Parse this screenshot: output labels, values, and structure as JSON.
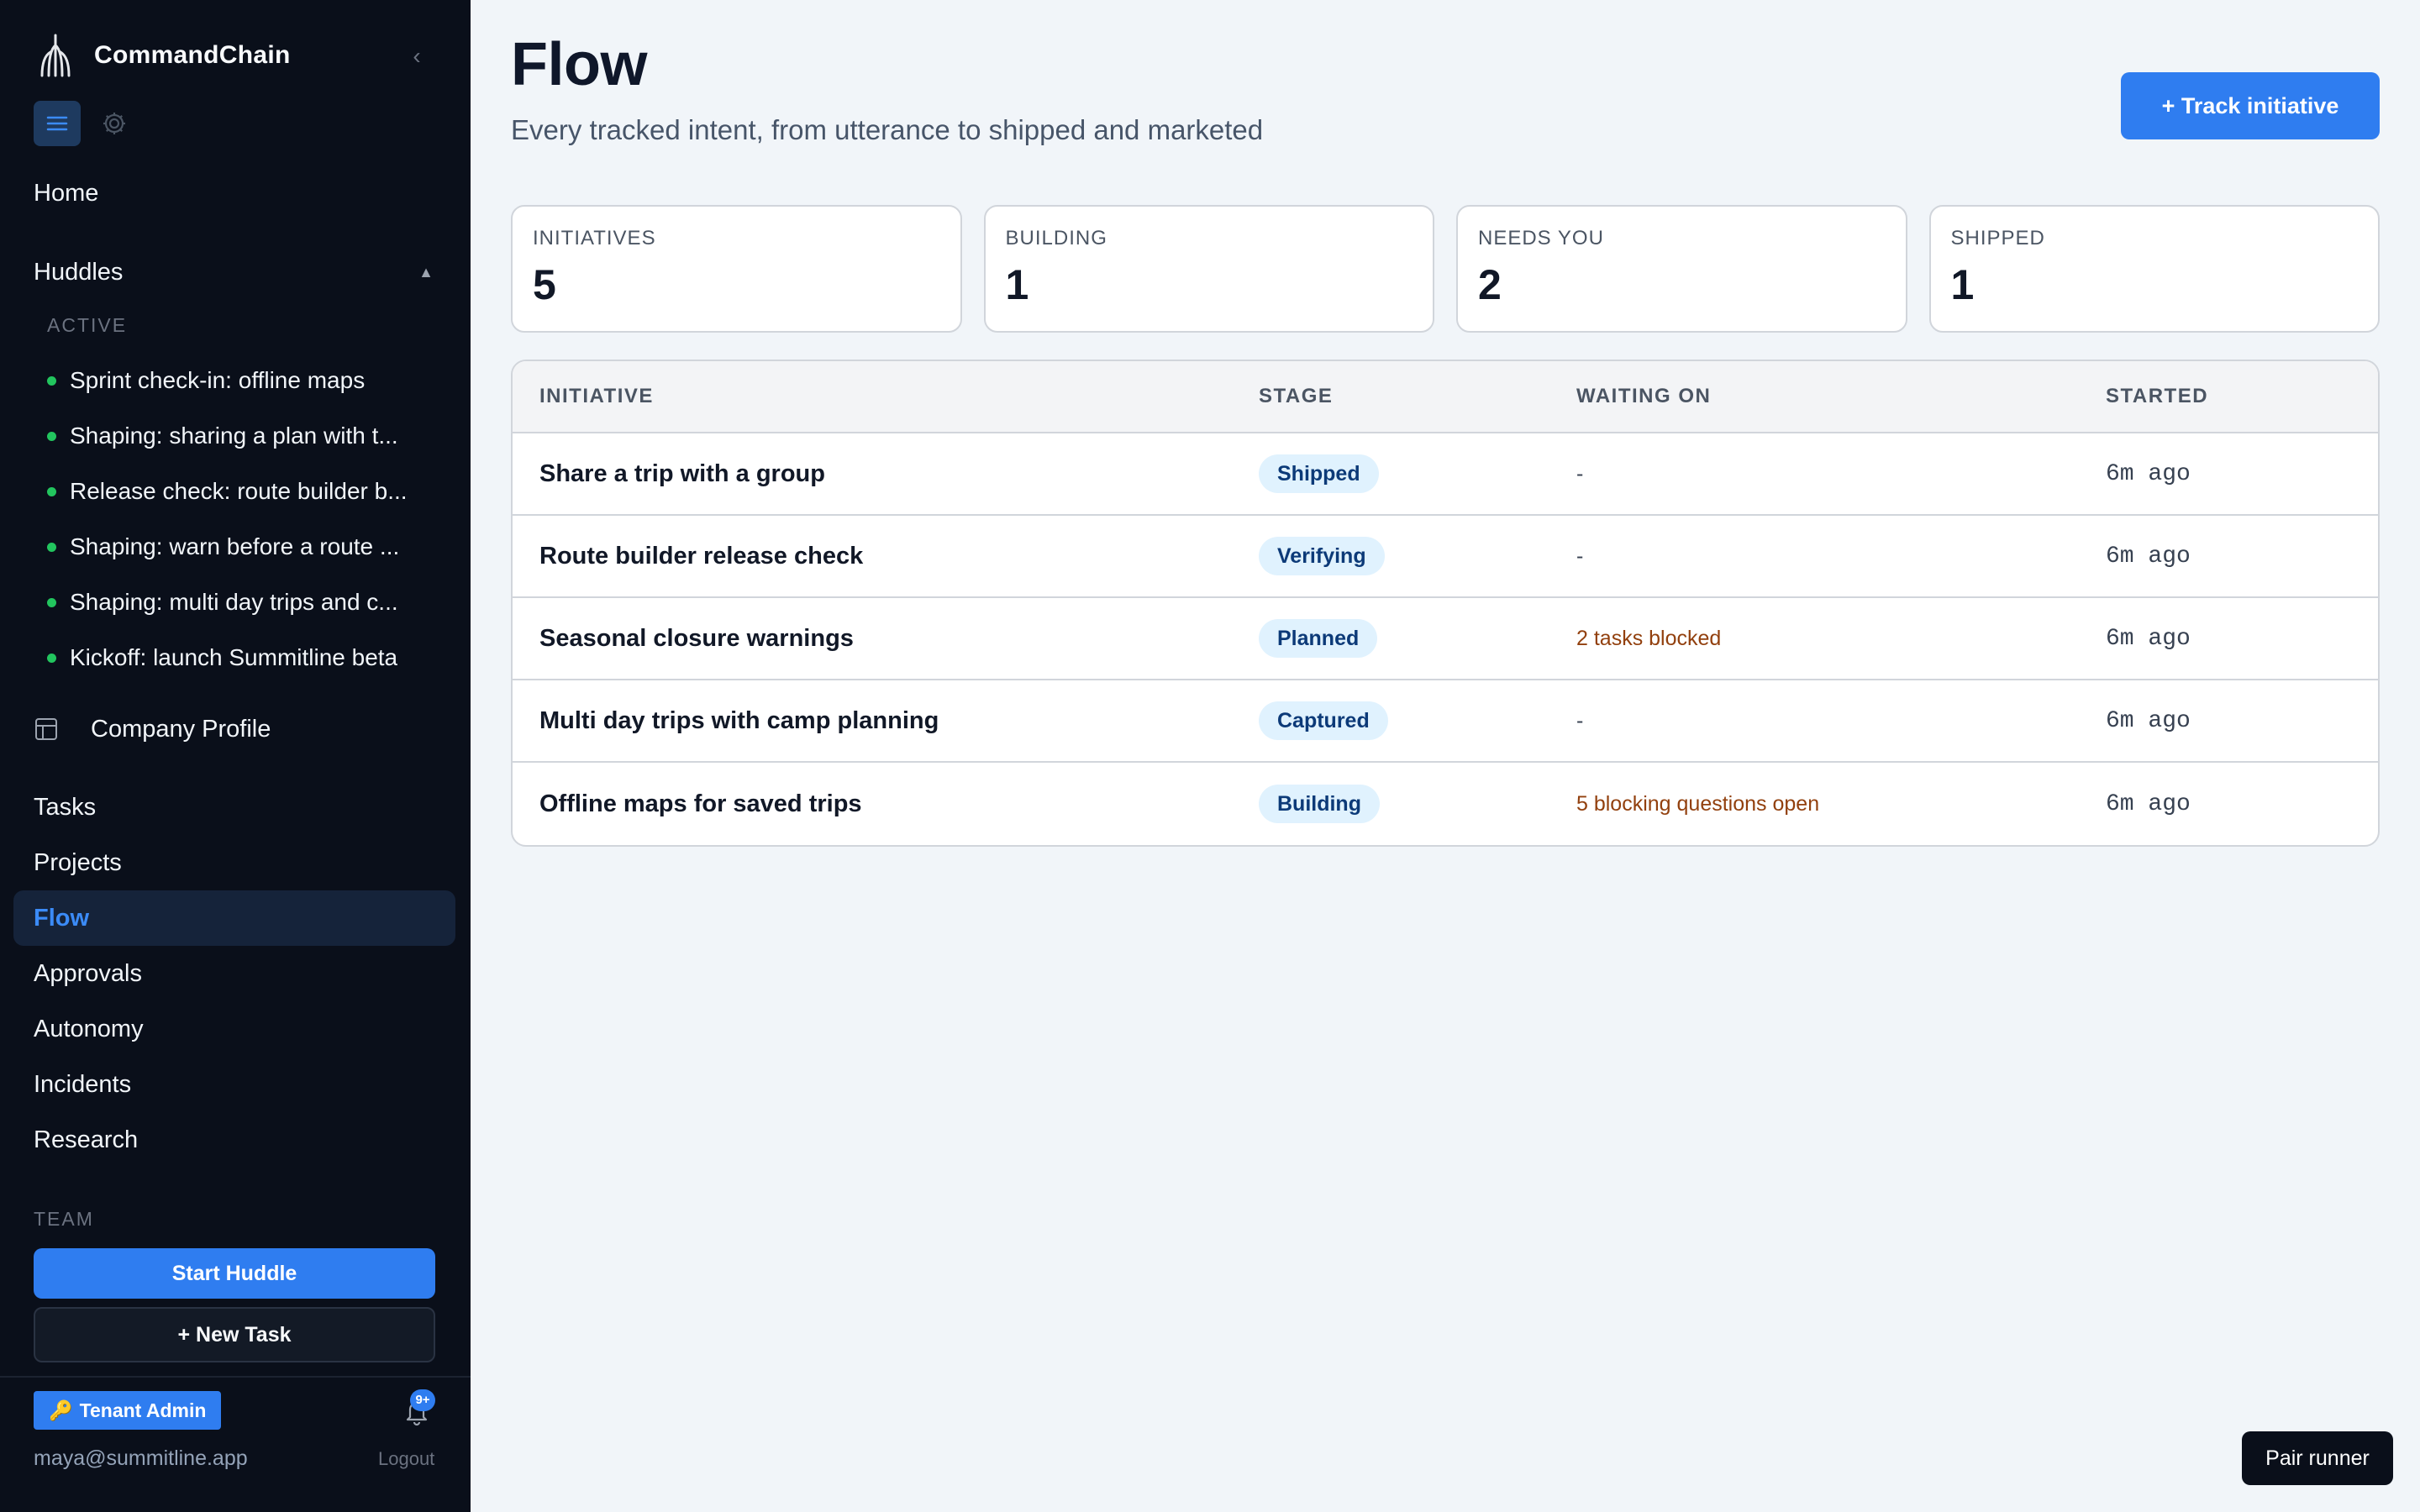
{
  "app": {
    "brand_name": "CommandChain",
    "collapse_icon": "chevron-left-icon"
  },
  "sidebar": {
    "home_label": "Home",
    "huddles": {
      "label": "Huddles",
      "caret": "▲",
      "section_label": "ACTIVE",
      "items": [
        "Sprint check-in: offline maps",
        "Shaping: sharing a plan with t...",
        "Release check: route builder b...",
        "Shaping: warn before a route ...",
        "Shaping: multi day trips and c...",
        "Kickoff: launch Summitline beta"
      ],
      "status_color": "#22c55e"
    },
    "company_profile_label": "Company Profile",
    "nav": [
      {
        "label": "Tasks",
        "active": false
      },
      {
        "label": "Projects",
        "active": false
      },
      {
        "label": "Flow",
        "active": true
      },
      {
        "label": "Approvals",
        "active": false
      },
      {
        "label": "Autonomy",
        "active": false
      },
      {
        "label": "Incidents",
        "active": false
      },
      {
        "label": "Research",
        "active": false
      }
    ],
    "team_label": "TEAM",
    "start_huddle_label": "Start Huddle",
    "new_task_label": "+ New Task",
    "tenant_badge": {
      "icon": "🔑",
      "label": "Tenant Admin"
    },
    "notifications_badge": "9+",
    "user_email": "maya@summitline.app",
    "logout_label": "Logout"
  },
  "main": {
    "title": "Flow",
    "subtitle": "Every tracked intent, from utterance to shipped and marketed",
    "track_button_label": "+ Track initiative",
    "stats": [
      {
        "label": "INITIATIVES",
        "value": "5"
      },
      {
        "label": "BUILDING",
        "value": "1"
      },
      {
        "label": "NEEDS YOU",
        "value": "2"
      },
      {
        "label": "SHIPPED",
        "value": "1"
      }
    ],
    "table": {
      "columns": [
        "INITIATIVE",
        "STAGE",
        "WAITING ON",
        "STARTED"
      ],
      "rows": [
        {
          "initiative": "Share a trip with a group",
          "stage": "Shipped",
          "waiting_on": "-",
          "started": "6m ago"
        },
        {
          "initiative": "Route builder release check",
          "stage": "Verifying",
          "waiting_on": "-",
          "started": "6m ago"
        },
        {
          "initiative": "Seasonal closure warnings",
          "stage": "Planned",
          "waiting_on": "2 tasks blocked",
          "started": "6m ago"
        },
        {
          "initiative": "Multi day trips with camp planning",
          "stage": "Captured",
          "waiting_on": "-",
          "started": "6m ago"
        },
        {
          "initiative": "Offline maps for saved trips",
          "stage": "Building",
          "waiting_on": "5 blocking questions open",
          "started": "6m ago"
        }
      ]
    }
  },
  "pair_runner_label": "Pair runner",
  "colors": {
    "accent": "#2f7df0",
    "sidebar_bg": "#0a0f1a",
    "page_bg": "#f1f5f9",
    "warning_text": "#92400e",
    "badge_bg": "#e0f2fe"
  }
}
